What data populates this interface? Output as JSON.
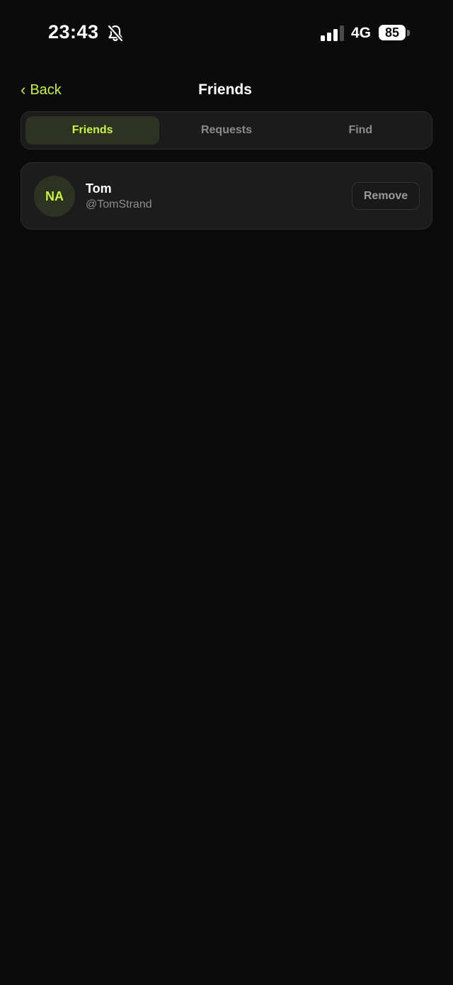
{
  "status_bar": {
    "time": "23:43",
    "network": "4G",
    "battery_percent": "85",
    "battery_level": 0.85,
    "signal_bars_active": 3,
    "signal_bars_total": 4,
    "mute_icon": "bell-slash-icon"
  },
  "nav": {
    "back_label": "Back",
    "title": "Friends"
  },
  "tabs": [
    {
      "label": "Friends",
      "active": true
    },
    {
      "label": "Requests",
      "active": false
    },
    {
      "label": "Find",
      "active": false
    }
  ],
  "friends": [
    {
      "initials": "NA",
      "name": "Tom",
      "handle": "@TomStrand",
      "action_label": "Remove"
    }
  ],
  "colors": {
    "accent": "#c8f244",
    "background": "#0b0b0b",
    "card": "#1c1c1c",
    "muted_text": "#8e8e8e"
  }
}
